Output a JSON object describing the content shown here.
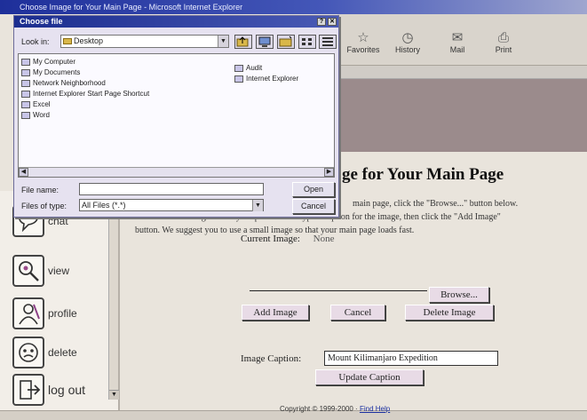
{
  "browser": {
    "title": "Choose Image for Your Main Page - Microsoft Internet Explorer",
    "toolbar": [
      {
        "label": "Favorites",
        "icon": "favorites-icon"
      },
      {
        "label": "History",
        "icon": "history-icon"
      },
      {
        "label": "Mail",
        "icon": "mail-icon"
      },
      {
        "label": "Print",
        "icon": "print-icon"
      }
    ]
  },
  "dialog": {
    "title": "Choose file",
    "look_in_label": "Look in:",
    "look_in_value": "Desktop",
    "items_left": [
      "My Computer",
      "My Documents",
      "Network Neighborhood",
      "Internet Explorer Start Page Shortcut",
      "Excel",
      "Word"
    ],
    "items_right": [
      "Audit",
      "Internet Explorer"
    ],
    "file_name_label": "File name:",
    "file_name_value": "",
    "files_of_type_label": "Files of type:",
    "files_of_type_value": "All Files (*.*)",
    "open_button": "Open",
    "cancel_button": "Cancel",
    "close_glyph": "✕",
    "help_glyph": "?"
  },
  "nav": {
    "items": [
      {
        "label": "chat",
        "icon": "chat-icon"
      },
      {
        "label": "view",
        "icon": "view-icon"
      },
      {
        "label": "profile",
        "icon": "profile-icon"
      },
      {
        "label": "delete",
        "icon": "delete-icon"
      },
      {
        "label": "log out",
        "icon": "log-out-icon"
      }
    ]
  },
  "main": {
    "title": "ge for Your Main Page",
    "instructions": [
      "main page, click the \"Browse...\" button below.",
      "Search in the dialog box for your picture file. Type a caption for the image, then click the \"Add Image\"",
      "button. We suggest you to use a small image so that your main page loads fast."
    ],
    "current_image_label": "Current Image:",
    "current_image_value": "None",
    "browse_button": "Browse...",
    "add_image_button": "Add Image",
    "cancel_button": "Cancel",
    "delete_image_button": "Delete Image",
    "caption_label": "Image Caption:",
    "caption_value": "Mount Kilimanjaro Expedition",
    "update_caption_button": "Update Caption",
    "footer_prefix": "Copyright © 1999-2000 · ",
    "footer_link": "Find Help"
  }
}
